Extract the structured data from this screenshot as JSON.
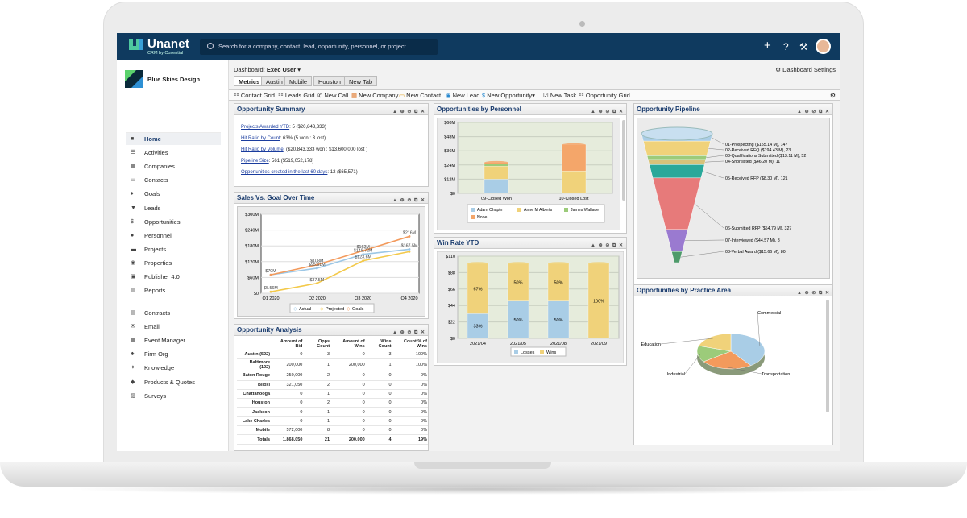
{
  "app": {
    "name": "Unanet",
    "sub": "CRM by Cosential",
    "search_placeholder": "Search for a company, contact, lead, opportunity, personnel, or project"
  },
  "topbar_icons": [
    "plus-icon",
    "help-icon",
    "tools-icon"
  ],
  "sidebar": {
    "company": "Blue Skies Design",
    "items": [
      {
        "label": "Home",
        "icon": "home-icon"
      },
      {
        "label": "Activities",
        "icon": "list-icon"
      },
      {
        "label": "Companies",
        "icon": "building-icon"
      },
      {
        "label": "Contacts",
        "icon": "contact-card-icon"
      },
      {
        "label": "Goals",
        "icon": "trophy-icon"
      },
      {
        "label": "Leads",
        "icon": "filter-icon"
      },
      {
        "label": "Opportunities",
        "icon": "dollar-icon"
      },
      {
        "label": "Personnel",
        "icon": "person-icon"
      },
      {
        "label": "Projects",
        "icon": "briefcase-icon"
      },
      {
        "label": "Properties",
        "icon": "map-pin-icon"
      },
      {
        "label": "Publisher 4.0",
        "icon": "publisher-icon"
      },
      {
        "label": "Reports",
        "icon": "report-icon"
      }
    ],
    "items2": [
      {
        "label": "Contracts",
        "icon": "contract-icon"
      },
      {
        "label": "Email",
        "icon": "mail-icon"
      },
      {
        "label": "Event Manager",
        "icon": "calendar-icon"
      },
      {
        "label": "Firm Org",
        "icon": "org-icon"
      },
      {
        "label": "Knowledge",
        "icon": "bulb-icon"
      },
      {
        "label": "Products & Quotes",
        "icon": "tag-icon"
      },
      {
        "label": "Surveys",
        "icon": "survey-icon"
      }
    ]
  },
  "dashboard": {
    "label": "Dashboard:",
    "name": "Exec User",
    "settings": "Dashboard Settings",
    "tabs": [
      "Metrics",
      "Austin",
      "Mobile",
      "Houston",
      "New Tab"
    ]
  },
  "toolbar": [
    "Contact Grid",
    "Leads Grid",
    "New Call",
    "New Company",
    "New Contact",
    "New Lead",
    "New Opportunity",
    "New Task",
    "Opportunity Grid"
  ],
  "toolbar_icons": [
    "grid-icon",
    "grid-icon",
    "phone-icon",
    "company-icon",
    "contact-icon",
    "lead-icon",
    "dollar-icon",
    "check-icon",
    "grid-icon"
  ],
  "panels": {
    "summary": {
      "title": "Opportunity Summary",
      "rows": [
        {
          "link": "Projects Awarded YTD",
          "text": ": 5 ($20,843,333)"
        },
        {
          "link": "Hit Ratio by Count",
          "text": ": 63% (5 won : 3 lost)"
        },
        {
          "link": "Hit Ratio by Volume",
          "text": ": ($20,843,333 won : $13,600,000 lost )"
        },
        {
          "link": "Pipeline Size",
          "text": ": 561 ($519,052,178)"
        },
        {
          "link": "Opportunities created in the last 60 days",
          "text": ": 12 ($65,571)"
        }
      ]
    },
    "personnel": {
      "title": "Opportunities by Personnel"
    },
    "pipeline": {
      "title": "Opportunity Pipeline"
    },
    "sales": {
      "title": "Sales Vs. Goal Over Time"
    },
    "winrate": {
      "title": "Win Rate YTD"
    },
    "practice": {
      "title": "Opportunities by Practice Area"
    },
    "analysis": {
      "title": "Opportunity Analysis",
      "headers": [
        "",
        "Amount of Bid",
        "Opps Count",
        "Amount of Wins",
        "Wins Count",
        "Count % of Wins"
      ],
      "rows": [
        [
          "Austin (502)",
          "0",
          "3",
          "0",
          "3",
          "100%"
        ],
        [
          "Baltimore (102)",
          "200,000",
          "1",
          "200,000",
          "1",
          "100%"
        ],
        [
          "Baton Rouge",
          "250,000",
          "2",
          "0",
          "0",
          "0%"
        ],
        [
          "Biloxi",
          "321,050",
          "2",
          "0",
          "0",
          "0%"
        ],
        [
          "Chattanooga",
          "0",
          "1",
          "0",
          "0",
          "0%"
        ],
        [
          "Houston",
          "0",
          "2",
          "0",
          "0",
          "0%"
        ],
        [
          "Jackson",
          "0",
          "1",
          "0",
          "0",
          "0%"
        ],
        [
          "Lake Charles",
          "0",
          "1",
          "0",
          "0",
          "0%"
        ],
        [
          "Mobile",
          "572,000",
          "8",
          "0",
          "0",
          "0%"
        ]
      ],
      "totals": [
        "Totals",
        "1,868,050",
        "21",
        "200,000",
        "4",
        "19%"
      ]
    }
  },
  "chart_data": [
    {
      "type": "bar",
      "name": "Opportunities by Personnel",
      "categories": [
        "09-Closed Won",
        "10-Closed Lost"
      ],
      "ylim": [
        0,
        60
      ],
      "yticks": [
        "$0",
        "$12M",
        "$24M",
        "$36M",
        "$48M",
        "$60M"
      ],
      "series": [
        {
          "name": "Adam Chapin",
          "color": "#a9cde6",
          "values": [
            12,
            0
          ]
        },
        {
          "name": "Anne M Alberts",
          "color": "#f0d27a",
          "values": [
            11,
            19
          ]
        },
        {
          "name": "James Wallace",
          "color": "#9ccb7a",
          "values": [
            2,
            0
          ]
        },
        {
          "name": "None",
          "color": "#f4a66a",
          "values": [
            1,
            22
          ]
        }
      ]
    },
    {
      "type": "line",
      "name": "Sales Vs. Goal Over Time",
      "categories": [
        "Q1 2020",
        "Q2 2020",
        "Q3 2020",
        "Q4 2020"
      ],
      "ylim": [
        0,
        300
      ],
      "yticks": [
        "$0",
        "$60M",
        "$120M",
        "$180M",
        "$240M",
        "$300M"
      ],
      "series": [
        {
          "name": "Actual",
          "color": "#9cc7e6",
          "values": [
            70,
            95,
            148,
            167
          ]
        },
        {
          "name": "Projected",
          "color": "#f3c94a",
          "values": [
            5.56,
            37.5,
            123.6,
            158
          ]
        },
        {
          "name": "Goals",
          "color": "#f39a5c",
          "values": [
            70,
            108,
            162,
            216
          ]
        }
      ],
      "labels": [
        "$70M",
        "$5.56M",
        "$108M",
        "$95.61M",
        "$37.5M",
        "$162M",
        "$148.72M",
        "$123.6M",
        "$216M",
        "$167.5M"
      ]
    },
    {
      "type": "bar",
      "name": "Win Rate YTD",
      "categories": [
        "2021/04",
        "2021/05",
        "2021/08",
        "2021/09"
      ],
      "ylim": [
        0,
        110
      ],
      "yticks": [
        "$0",
        "$22",
        "$44",
        "$66",
        "$88",
        "$110"
      ],
      "series": [
        {
          "name": "Losses",
          "color": "#a9cde6",
          "values": [
            33,
            50,
            50,
            0
          ]
        },
        {
          "name": "Wins",
          "color": "#f0d27a",
          "values": [
            67,
            50,
            50,
            100
          ]
        }
      ],
      "value_labels": [
        [
          "33%",
          "50%",
          "50%",
          "0%"
        ],
        [
          "67%",
          "50%",
          "50%",
          "100%"
        ]
      ]
    },
    {
      "type": "funnel",
      "name": "Opportunity Pipeline",
      "stages": [
        "01-Prospecting ($155.14 M), 147",
        "02-Received RFQ ($194.43 M), 23",
        "03-Qualifications Submitted ($13.11 M), 52",
        "04-Shortlisted ($46.20 M), 11",
        "05-Received RFP ($8.30 M), 121",
        "06-Submitted RFP ($54.79 M), 327",
        "07-Interviewed ($44.57 M), 8",
        "08-Verbal Award ($15.66 M), 80"
      ]
    },
    {
      "type": "pie",
      "name": "Opportunities by Practice Area",
      "slices": [
        {
          "label": "Commercial",
          "value": 40,
          "color": "#a9cde6"
        },
        {
          "label": "Transportation",
          "value": 25,
          "color": "#f39a5c"
        },
        {
          "label": "Industrial",
          "value": 15,
          "color": "#9ccb7a"
        },
        {
          "label": "Education",
          "value": 20,
          "color": "#f0d27a"
        }
      ]
    }
  ]
}
